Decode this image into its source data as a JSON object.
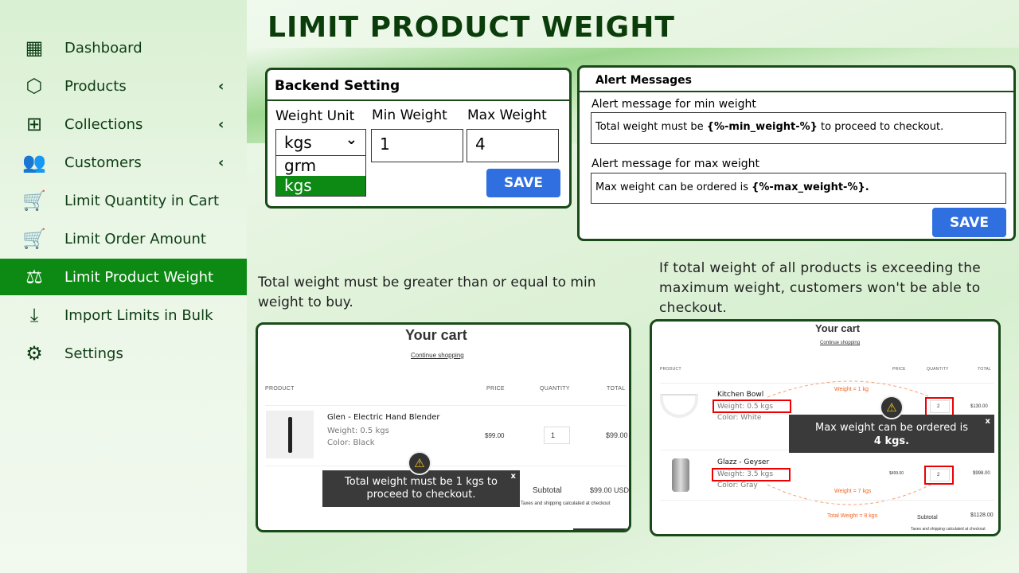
{
  "sidebar": {
    "items": [
      {
        "label": "Dashboard",
        "icon": "dashboard-icon"
      },
      {
        "label": "Products",
        "icon": "box-icon",
        "chevron": true
      },
      {
        "label": "Collections",
        "icon": "collections-icon",
        "chevron": true
      },
      {
        "label": "Customers",
        "icon": "customers-icon",
        "chevron": true
      },
      {
        "label": "Limit Quantity in Cart",
        "icon": "cart-icon"
      },
      {
        "label": "Limit Order Amount",
        "icon": "cart-dollar-icon"
      },
      {
        "label": "Limit Product Weight",
        "icon": "weight-icon",
        "active": true
      },
      {
        "label": "Import Limits in Bulk",
        "icon": "import-icon"
      },
      {
        "label": "Settings",
        "icon": "gear-icon"
      }
    ]
  },
  "page_title": "LIMIT PRODUCT WEIGHT",
  "backend": {
    "title": "Backend Setting",
    "weight_unit_label": "Weight Unit",
    "min_label": "Min Weight",
    "max_label": "Max Weight",
    "unit_value": "kgs",
    "unit_options": [
      "grm",
      "kgs"
    ],
    "min_value": "1",
    "max_value": "4",
    "save": "SAVE"
  },
  "alerts": {
    "title": "Alert Messages",
    "min_label": "Alert message for min weight",
    "min_prefix": "Total weight must be ",
    "min_token": "{%-min_weight-%}",
    "min_suffix": " to proceed to checkout.",
    "max_label": "Alert message for max weight",
    "max_prefix": "Max weight can be ordered is ",
    "max_token": "{%-max_weight-%}.",
    "save": "SAVE"
  },
  "desc_left": "Total weight must be greater than or equal to min weight to buy.",
  "desc_right": "If total weight of all products is exceeding the maximum weight, customers won't be able to checkout.",
  "cart1": {
    "title": "Your cart",
    "continue": "Continue shopping",
    "headers": [
      "PRODUCT",
      "PRICE",
      "QUANTITY",
      "TOTAL"
    ],
    "item": {
      "name": "Glen - Electric Hand Blender",
      "weight": "Weight: 0.5 kgs",
      "color": "Color: Black",
      "price": "$99.00",
      "qty": "1",
      "total": "$99.00"
    },
    "subtotal_label": "Subtotal",
    "subtotal": "$99.00 USD",
    "taxes": "Taxes and shipping calculated at checkout",
    "toast": "Total weight must be 1 kgs to proceed to checkout.",
    "close": "x"
  },
  "cart2": {
    "title": "Your cart",
    "continue": "Continue shopping",
    "headers": [
      "PRODUCT",
      "PRICE",
      "QUANTITY",
      "TOTAL"
    ],
    "items": [
      {
        "name": "Kitchen Bowl",
        "weight": "Weight: 0.5 kgs",
        "color": "Color: White",
        "price": "",
        "qty": "2",
        "total": "$130.00",
        "note": "Weight = 1 kg"
      },
      {
        "name": "Glazz - Geyser",
        "weight": "Weight: 3.5 kgs",
        "color": "Color: Gray",
        "price": "$499.00",
        "qty": "2",
        "total": "$998.00",
        "note": "Weight = 7 kgs"
      }
    ],
    "total_weight": "Total Weight = 8 kgs",
    "subtotal_label": "Subtotal",
    "subtotal": "$1128.00",
    "taxes": "Taxes and shipping calculated at checkout",
    "toast_line1": "Max weight can be ordered is",
    "toast_line2": "4 kgs.",
    "close": "x"
  },
  "colors": {
    "accent_green": "#0c8a14",
    "dark_green": "#0b3d0b",
    "button_blue": "#2f6fe0",
    "highlight_red": "#e00000",
    "note_orange": "#f26522"
  }
}
